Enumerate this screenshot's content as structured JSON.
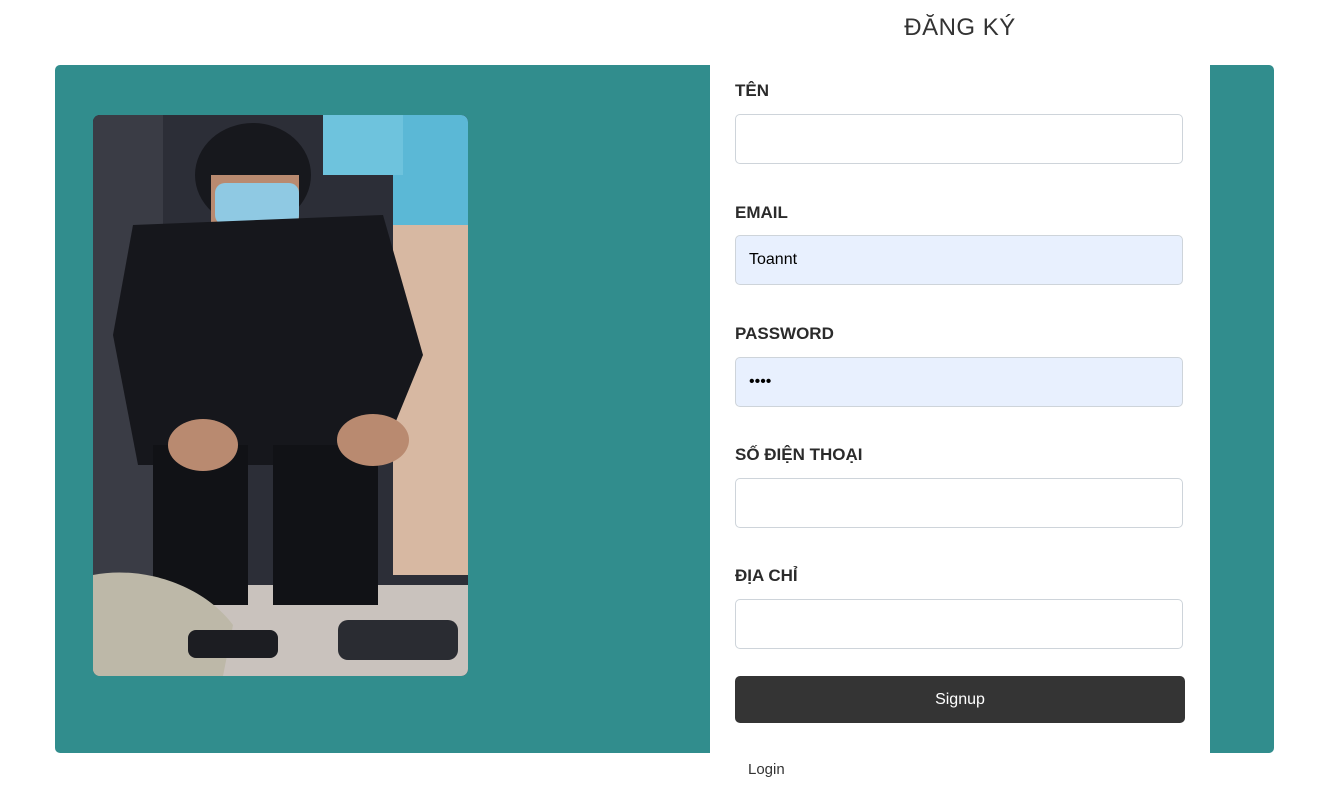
{
  "page": {
    "title": "ĐĂNG KÝ"
  },
  "form": {
    "fields": [
      {
        "label": "TÊN",
        "value": "",
        "type": "text"
      },
      {
        "label": "EMAIL",
        "value": "Toannt",
        "type": "text"
      },
      {
        "label": "PASSWORD",
        "value": "••••",
        "type": "password"
      },
      {
        "label": "SỐ ĐIỆN THOẠI",
        "value": "",
        "type": "text"
      },
      {
        "label": "ĐỊA CHỈ",
        "value": "",
        "type": "text"
      }
    ],
    "signup_label": "Signup",
    "login_label": "Login"
  },
  "colors": {
    "panel": "#318d8d",
    "button": "#343434",
    "autofill": "#e8f0fe"
  },
  "image": {
    "icon": "user-photo"
  }
}
